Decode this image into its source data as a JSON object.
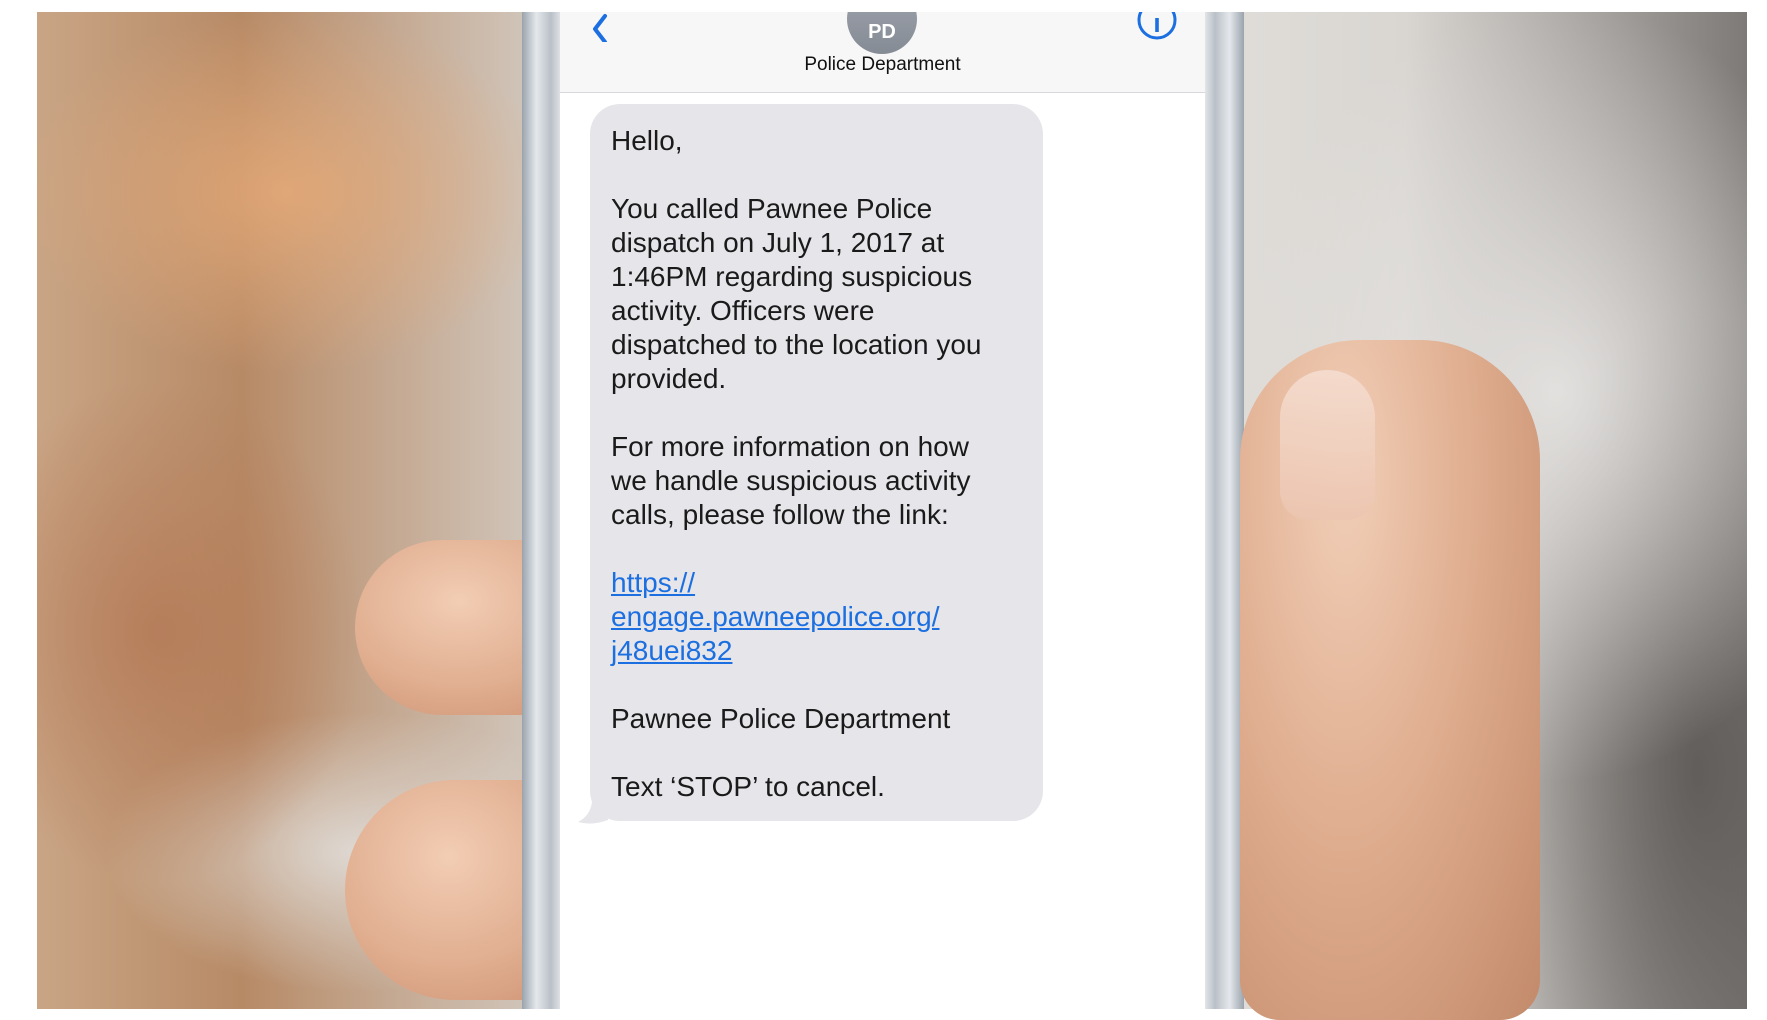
{
  "conversation": {
    "contact_initials": "PD",
    "contact_name": "Police Department",
    "icons": {
      "back": "chevron-left-icon",
      "info": "info-icon"
    }
  },
  "message": {
    "greeting": "Hello,",
    "paragraph_1_lines": [
      "You called Pawnee Police",
      "dispatch on July 1, 2017 at",
      "1:46PM regarding suspicious",
      "activity. Officers were",
      "dispatched to the location you",
      "provided."
    ],
    "paragraph_2_lines": [
      "For more information on how",
      "we handle suspicious activity",
      "calls, please follow the link:"
    ],
    "link_lines": [
      "https://",
      "engage.pawneepolice.org/",
      "j48uei832"
    ],
    "signature": "Pawnee Police Department",
    "opt_out": "Text ‘STOP’ to cancel."
  },
  "colors": {
    "accent": "#1b6fe0",
    "bubble": "#e6e5ea"
  }
}
